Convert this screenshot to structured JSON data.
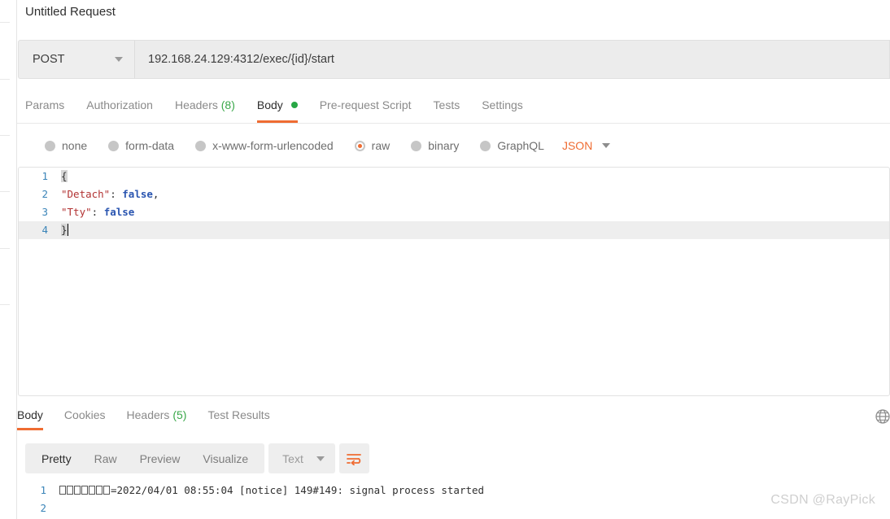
{
  "window": {
    "request_title": "Untitled Request",
    "watermark": "CSDN @RayPick"
  },
  "url_bar": {
    "method": "POST",
    "url": "192.168.24.129:4312/exec/{id}/start",
    "method_caret_icon": "chevron-down-icon"
  },
  "request_tabs": [
    {
      "label": "Params",
      "active": false
    },
    {
      "label": "Authorization",
      "active": false
    },
    {
      "label": "Headers",
      "count": "(8)",
      "active": false
    },
    {
      "label": "Body",
      "active": true,
      "dot": "green-dot"
    },
    {
      "label": "Pre-request Script",
      "active": false
    },
    {
      "label": "Tests",
      "active": false
    },
    {
      "label": "Settings",
      "active": false
    }
  ],
  "body_type": {
    "options": [
      {
        "label": "none",
        "selected": false
      },
      {
        "label": "form-data",
        "selected": false
      },
      {
        "label": "x-www-form-urlencoded",
        "selected": false
      },
      {
        "label": "raw",
        "selected": true
      },
      {
        "label": "binary",
        "selected": false
      },
      {
        "label": "GraphQL",
        "selected": false
      }
    ],
    "format": "JSON",
    "format_caret_icon": "chevron-down-icon",
    "accent_color": "#ef6c32"
  },
  "editor": {
    "lines": [
      {
        "num": "1",
        "open_brace": "{"
      },
      {
        "num": "2",
        "key": "\"Detach\"",
        "colon": ": ",
        "value": "false",
        "comma": ","
      },
      {
        "num": "3",
        "key": "\"Tty\"",
        "colon": ": ",
        "value": "false",
        "comma": ""
      },
      {
        "num": "4",
        "close_brace": "}"
      }
    ]
  },
  "response_tabs": [
    {
      "label": "Body",
      "active": true
    },
    {
      "label": "Cookies",
      "active": false
    },
    {
      "label": "Headers",
      "count": "(5)",
      "active": false
    },
    {
      "label": "Test Results",
      "active": false
    }
  ],
  "response_toolbar": {
    "view_modes": [
      {
        "label": "Pretty",
        "active": true
      },
      {
        "label": "Raw",
        "active": false
      },
      {
        "label": "Preview",
        "active": false
      },
      {
        "label": "Visualize",
        "active": false
      }
    ],
    "type": "Text",
    "type_caret_icon": "chevron-down-icon",
    "wrap_icon": "word-wrap-icon",
    "globe_icon": "globe-icon"
  },
  "response_body": {
    "lines": [
      {
        "num": "1",
        "unreadable_count": 7,
        "text": "=2022/04/01 08:55:04 [notice] 149#149: signal process started"
      },
      {
        "num": "2",
        "unreadable_count": 0,
        "text": ""
      }
    ]
  }
}
